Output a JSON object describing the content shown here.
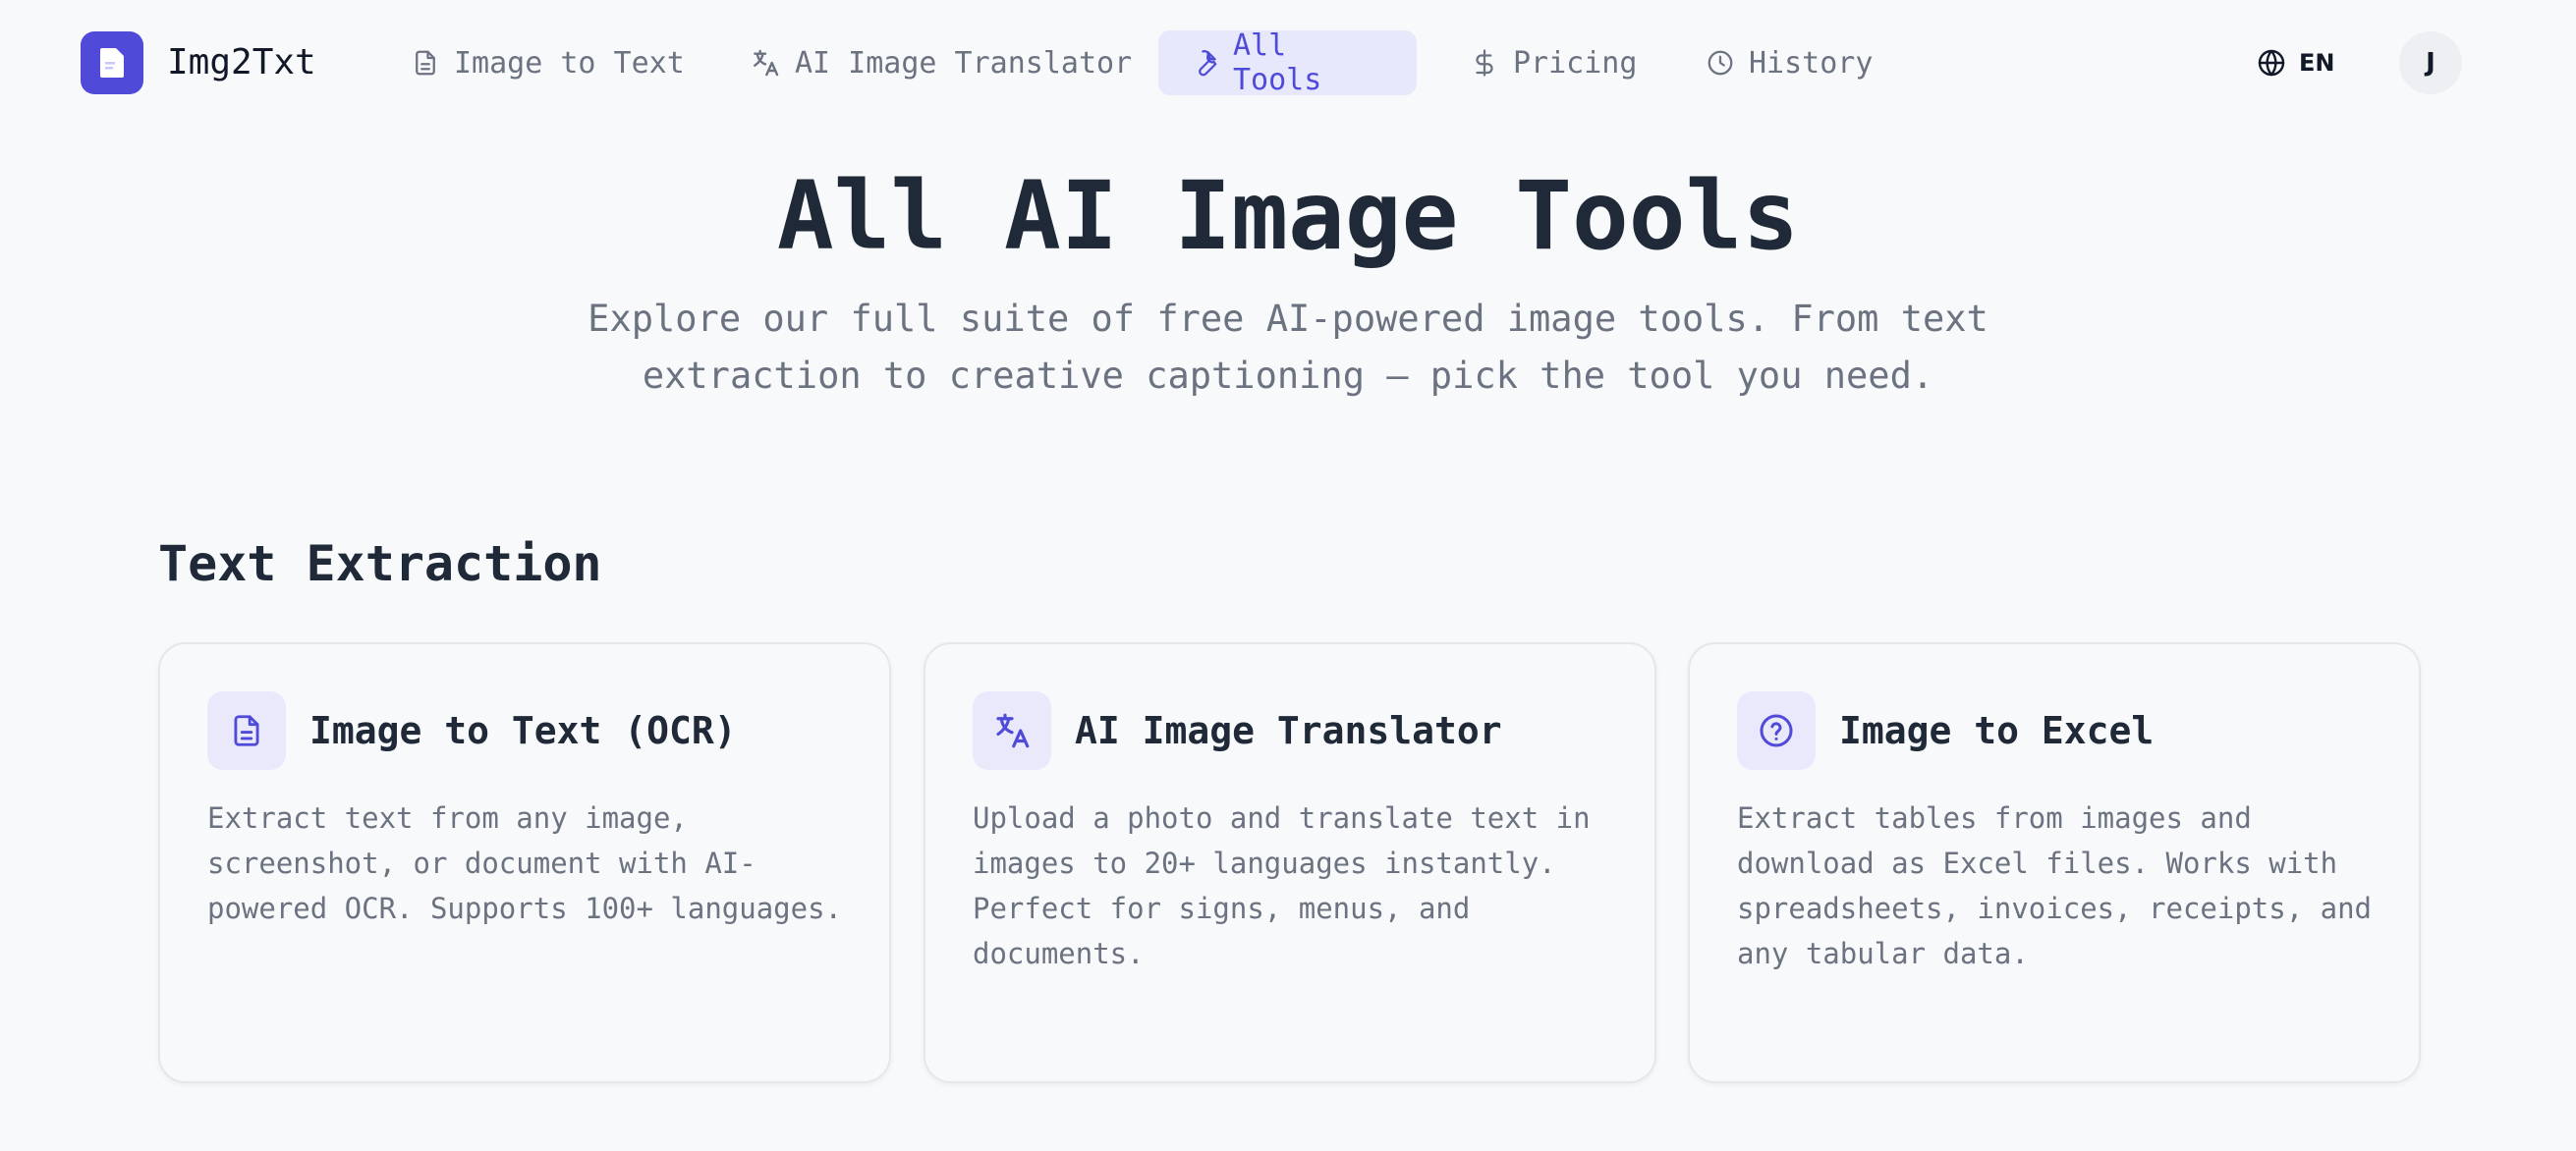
{
  "brand": {
    "name": "Img2Txt",
    "icon": "document-icon"
  },
  "nav": {
    "items": [
      {
        "label": "Image to Text",
        "icon": "document-icon"
      },
      {
        "label": "AI Image Translator",
        "icon": "translate-icon"
      },
      {
        "label": "All Tools",
        "icon": "wrench-icon",
        "active": true
      },
      {
        "label": "Pricing",
        "icon": "dollar-icon"
      },
      {
        "label": "History",
        "icon": "clock-icon"
      }
    ],
    "language": {
      "label": "EN",
      "icon": "globe-icon"
    },
    "avatar": "J"
  },
  "hero": {
    "title": "All AI Image Tools",
    "subtitle_line1": "Explore our full suite of free AI-powered image tools. From text",
    "subtitle_line2": "extraction to creative captioning — pick the tool you need."
  },
  "section": {
    "title": "Text Extraction",
    "cards": [
      {
        "title": "Image to Text (OCR)",
        "icon": "document-icon",
        "description": "Extract text from any image, screenshot, or document with AI-powered OCR. Supports 100+ languages."
      },
      {
        "title": "AI Image Translator",
        "icon": "translate-icon",
        "description": "Upload a photo and translate text in images to 20+ languages instantly. Perfect for signs, menus, and documents."
      },
      {
        "title": "Image to Excel",
        "icon": "question-circle-icon",
        "description": "Extract tables from images and download as Excel files. Works with spreadsheets, invoices, receipts, and any tabular data."
      }
    ]
  },
  "colors": {
    "accent": "#4f4ad8",
    "active_bg": "#e7e8fb",
    "text": "#1f2937",
    "muted": "#6b7280"
  }
}
